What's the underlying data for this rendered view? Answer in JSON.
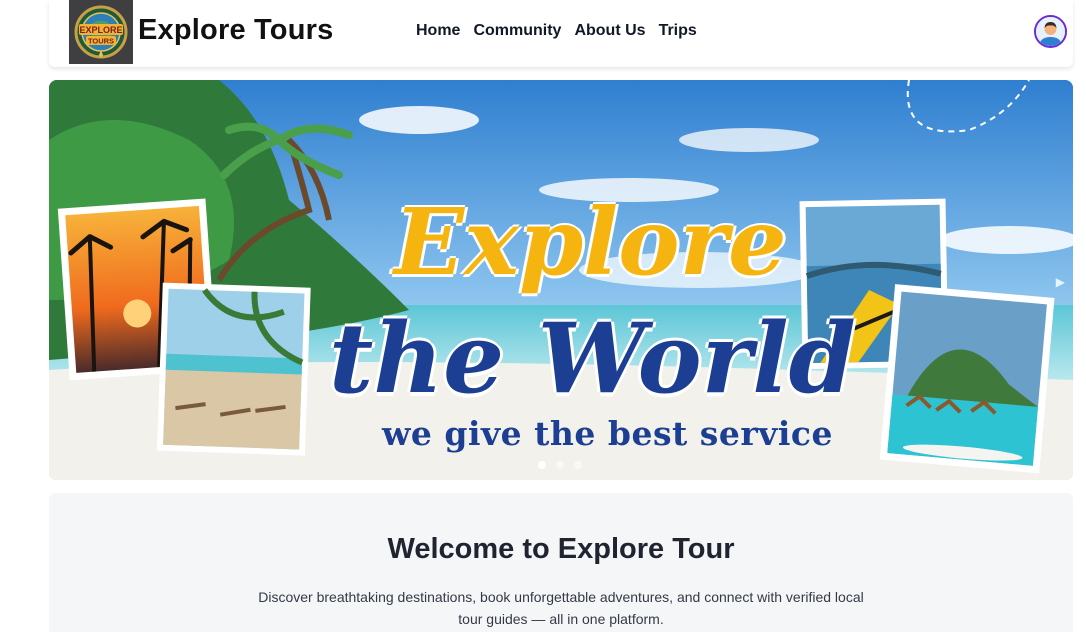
{
  "navbar": {
    "logo_text_line1": "EXPLORE",
    "logo_text_line2": "TOURS",
    "brand": "Explore Tours",
    "links": [
      {
        "label": "Home"
      },
      {
        "label": "Community"
      },
      {
        "label": "About Us"
      },
      {
        "label": "Trips"
      }
    ],
    "avatar_icon": "user-avatar-icon"
  },
  "hero": {
    "headline_line1": "Explore",
    "headline_line2": "the World",
    "tagline": "we give the best service",
    "slides_count": 3,
    "active_slide": 1,
    "colors": {
      "headline_yellow": "#f5b40f",
      "headline_blue": "#1c3f94",
      "sky": "#3d8fd6"
    }
  },
  "welcome": {
    "title": "Welcome to Explore Tour",
    "text": "Discover breathtaking destinations, book unforgettable adventures, and connect with verified local tour guides — all in one platform."
  }
}
